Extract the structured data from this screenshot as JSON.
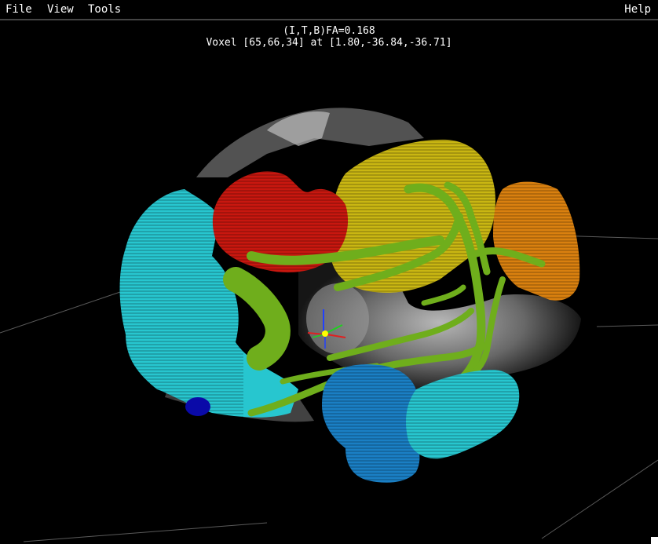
{
  "menubar": {
    "file_label": "File",
    "view_label": "View",
    "tools_label": "Tools",
    "help_label": "Help"
  },
  "viewer": {
    "fa_readout": "(I,T,B)FA=0.168",
    "voxel_readout": "Voxel [65,66,34] at [1.80,-36.84,-36.71]"
  },
  "colors": {
    "background": "#000000",
    "text": "#ffffff",
    "region_red": "#c8170f",
    "region_yellow": "#c9b612",
    "region_orange": "#d9800f",
    "region_cyan": "#27c6cf",
    "region_blue": "#1a7fc4",
    "tract_green": "#6fae1c",
    "dark_blue": "#0a0aa8",
    "crosshair_center": "#ffff00"
  },
  "icons": {
    "cursor": "crosshair-icon"
  }
}
